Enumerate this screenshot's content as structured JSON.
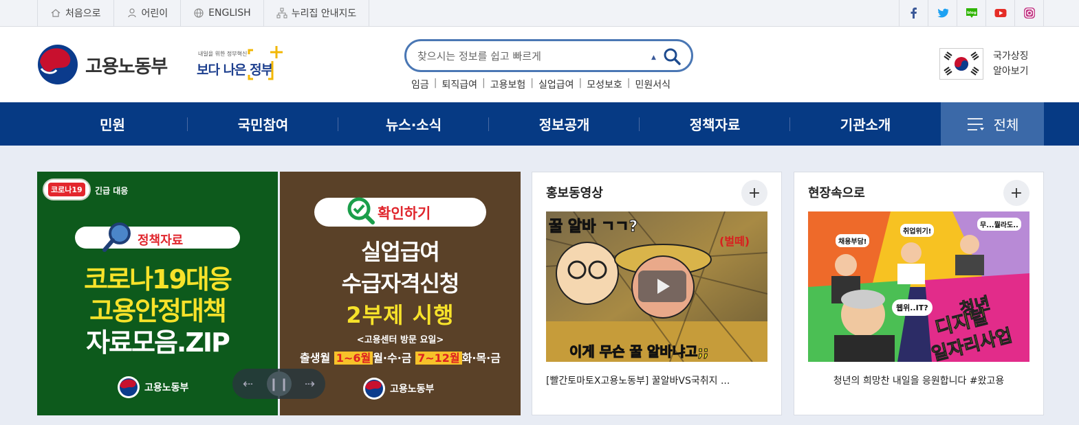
{
  "util": {
    "items": [
      {
        "label": "처음으로",
        "icon": "home-icon"
      },
      {
        "label": "어린이",
        "icon": "person-icon"
      },
      {
        "label": "ENGLISH",
        "icon": "globe-icon"
      },
      {
        "label": "누리집 안내지도",
        "icon": "sitemap-icon"
      }
    ],
    "sns": [
      "facebook-icon",
      "twitter-icon",
      "blog-icon",
      "youtube-icon",
      "instagram-icon"
    ],
    "blog_label": "blog"
  },
  "header": {
    "logo_text": "고용노동부",
    "gov_small": "내일을 위한 정부혁신",
    "gov_big": "보다 나은 정부",
    "search_placeholder": "찾으시는 정보를 쉽고 빠르게",
    "quick_links": [
      "임금",
      "퇴직급여",
      "고용보험",
      "실업급여",
      "모성보호",
      "민원서식"
    ],
    "symbol_line1": "국가상징",
    "symbol_line2": "알아보기"
  },
  "nav": {
    "items": [
      "민원",
      "국민참여",
      "뉴스·소식",
      "정보공개",
      "정책자료",
      "기관소개"
    ],
    "all_label": "전체"
  },
  "banner_a": {
    "tag": "코로나19",
    "tag_label": "긴급 대응",
    "pill": "정책자료",
    "line1": "코로나19대응",
    "line2": "고용안정대책",
    "line3": "자료모음.ZIP",
    "brand": "고용노동부"
  },
  "banner_b": {
    "pill": "확인하기",
    "line1": "실업급여",
    "line2": "수급자격신청",
    "line3": "2부제 시행",
    "line4": "<고용센터 방문 요일>",
    "row_a": "출생월",
    "row_b": "1~6월",
    "row_c": "월·수·금",
    "row_d": "7~12월",
    "row_e": "화·목·금",
    "brand": "고용노동부"
  },
  "card_video": {
    "title": "홍보동영상",
    "plus": "+",
    "thumb_top": "꿀 알바 ㄱㄱ?",
    "thumb_tag": "(벌떼)",
    "thumb_bottom": "이게 무슨 꿀 알바냐고;;",
    "caption": "[빨간토마토X고용노동부] 꿀알바VS국취지 ..."
  },
  "card_field": {
    "title": "현장속으로",
    "plus": "+",
    "bubble1": "채용부담!",
    "bubble2": "취업위기!",
    "bubble3": "무...뭘라도..",
    "bubble4": "웹위..IT?",
    "big1": "청년",
    "big2": "디지털",
    "big3": "일자리사업",
    "caption": "청년의 희망찬 내일을 응원합니다 #왔고용"
  },
  "colors": {
    "nav": "#063a84",
    "nav_all": "#3b69a8",
    "search_border": "#4a77b4",
    "banner_green": "#0d5a1c",
    "banner_brown": "#5a4128",
    "highlight_yellow": "#f7e22a"
  }
}
